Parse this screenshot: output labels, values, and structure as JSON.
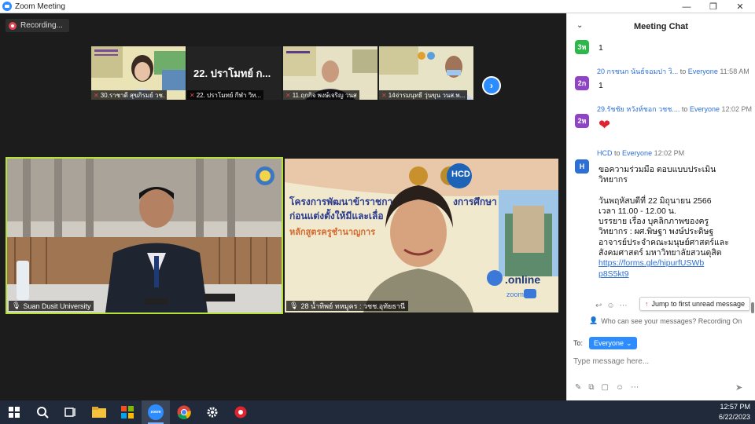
{
  "window": {
    "title": "Zoom Meeting",
    "minimize": "—",
    "restore": "❐",
    "close": "✕"
  },
  "recording": {
    "label": "Recording..."
  },
  "thumbnails": [
    {
      "name": "30.ราชาดี สุขภิรมย์ วช."
    },
    {
      "name": "22. ปราโมทย์ กีฬา วิท...",
      "overlay": "22. ปราโมทย์ ก..."
    },
    {
      "name": "11.ฤกกิจ พงษ์เจริญ วนส"
    },
    {
      "name": "14จ่ารมนุทธี วุ่นขุน วนส.พ..."
    }
  ],
  "main_tiles": [
    {
      "name": "Suan Dusit University"
    },
    {
      "name": "28 น้ำทิพย์ ทหมูคร : วชช.อุทัยธานี",
      "banner_line1": "โครงการพัฒนาข้าราชกา",
      "banner_line1b": "งการศึกษา",
      "banner_line2": "ก่อนแต่งตั้งให้มีและเลื่อ",
      "banner_line3": "หลักสูตรครูชำนาญการ",
      "brand": "HCD",
      "online": ".online",
      "zoom_small": "zoom"
    }
  ],
  "chat": {
    "title": "Meeting Chat",
    "messages": [
      {
        "avatar": "3ห",
        "avatar_color": "#2eb84b",
        "text": "1"
      },
      {
        "sender": "20 กรชนก นันธ์จอมปา วิ...",
        "to": "to",
        "recipient": "Everyone",
        "time": "11:58 AM",
        "avatar": "2ก",
        "avatar_color": "#8e44c4",
        "text": "1"
      },
      {
        "sender": "29.รัชชัย หวังห์ชอก วชช....",
        "to": "to",
        "recipient": "Everyone",
        "time": "12:02 PM",
        "avatar": "2ห",
        "avatar_color": "#8e44c4",
        "text": "❤"
      },
      {
        "sender": "HCD",
        "to": "to",
        "recipient": "Everyone",
        "time": "12:02 PM",
        "avatar": "H",
        "avatar_color": "#2d6fd6",
        "lines": [
          "ขอความร่วมมือ ตอบแบบประเมิน",
          "วิทยากร",
          "",
          "วันพฤหัสบดีที่ 22 มิถุนายน 2566",
          "เวลา 11.00 - 12.00 น.",
          "บรรยาย เรื่อง บุคลิกภาพของครู",
          "วิทยากร :  ผศ.พิษฐา  พงษ์ประดิษฐ",
          "อาจารย์ประจำคณะมนุษย์ศาสตร์และ",
          "สังคมศาสตร์ มหาวิทยาลัยสวนดุสิต"
        ],
        "link_line1": "https://forms.gle/hipurfUSWb",
        "link_line2": "p8S5kt9"
      }
    ],
    "jump_label": "Jump to first unread message",
    "visibility_note": "Who can see your messages? Recording On",
    "to_label": "To:",
    "recipient_button": "Everyone",
    "input_placeholder": "Type message here..."
  },
  "taskbar": {
    "time": "12:57 PM",
    "date": "6/22/2023",
    "zoom_label": "zoom"
  }
}
